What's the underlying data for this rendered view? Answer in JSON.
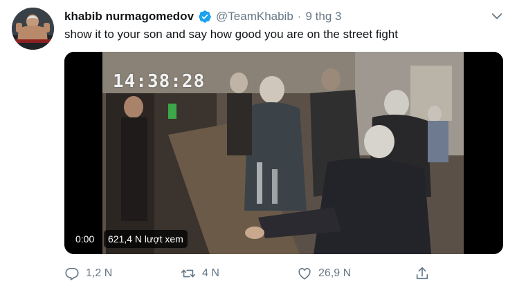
{
  "tweet": {
    "display_name": "khabib nurmagomedov",
    "handle": "@TeamKhabib",
    "separator": "·",
    "time": "9 thg 3",
    "text": "show it to your son and say how good you are on the street fight",
    "verified_icon": "verified-badge-icon",
    "menu_icon": "chevron-down-icon",
    "accent_color": "#1da1f2"
  },
  "video": {
    "cctv_timestamp": "14:38:28",
    "playback_time": "0:00",
    "view_count": "621,4 N lượt xem"
  },
  "actions": {
    "reply": {
      "icon": "reply-icon",
      "count": "1,2 N"
    },
    "retweet": {
      "icon": "retweet-icon",
      "count": "4 N"
    },
    "like": {
      "icon": "heart-icon",
      "count": "26,9 N"
    },
    "share": {
      "icon": "share-icon"
    }
  }
}
